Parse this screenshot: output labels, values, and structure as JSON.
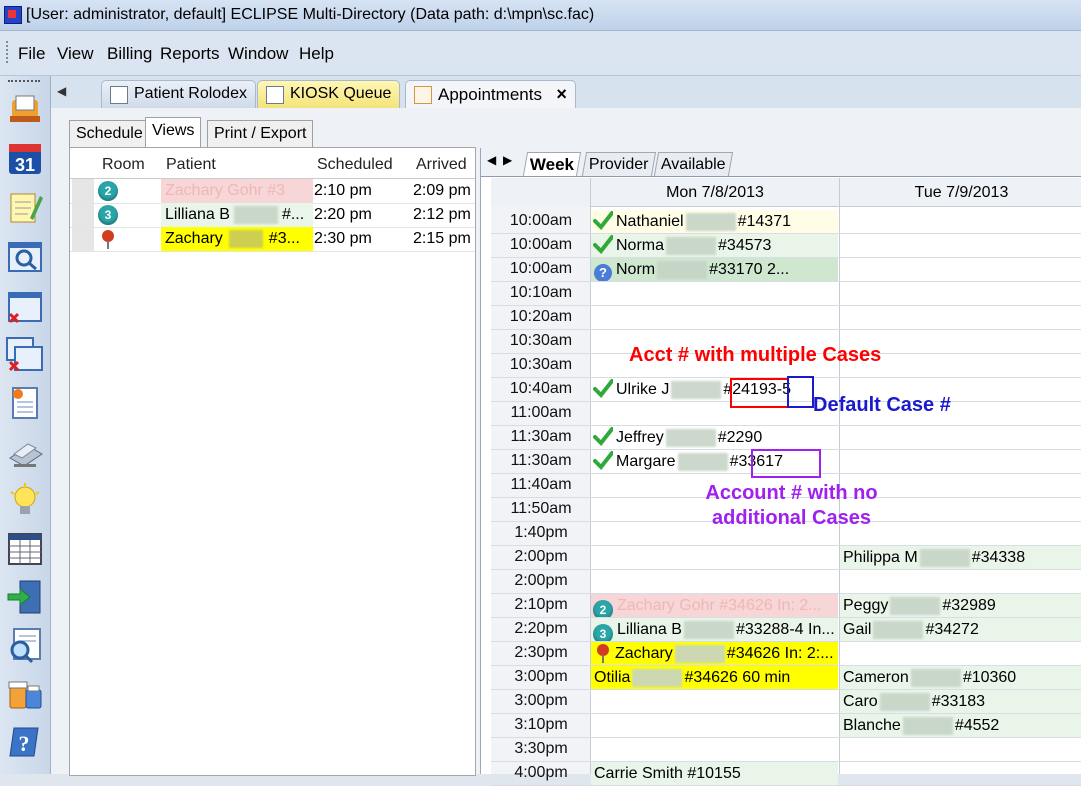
{
  "window": {
    "title": "[User: administrator, default]  ECLIPSE Multi-Directory (Data path: d:\\mpn\\sc.fac)"
  },
  "menu": [
    "File",
    "View",
    "Billing",
    "Reports",
    "Window",
    "Help"
  ],
  "toolbar_icons": [
    "rolodex-icon",
    "calendar-31-icon",
    "notepad-icon",
    "search-window-icon",
    "window-close-icon",
    "windows-close-icon",
    "report-icon",
    "scanner-icon",
    "lightbulb-icon",
    "grid-icon",
    "exit-door-icon",
    "search-list-icon",
    "medicine-icon",
    "help-icon"
  ],
  "toolbar_calendar_day": "31",
  "doc_tabs": [
    {
      "label": "Patient Rolodex"
    },
    {
      "label": "KIOSK Queue"
    },
    {
      "label": "Appointments",
      "active": true,
      "close": "×"
    }
  ],
  "sub_tabs": [
    "Schedule",
    "Views",
    "Print / Export"
  ],
  "left_table": {
    "headers": [
      "Room",
      "Patient",
      "Scheduled",
      "Arrived"
    ],
    "rows": [
      {
        "room": "2",
        "patient": "Zachary  Gohr #3",
        "scheduled": "2:10 pm",
        "arrived": "2:09 pm",
        "bg": "#f6d6d6",
        "textcolor": "#f1b6b6"
      },
      {
        "room": "3",
        "patient": "Lilliana B",
        "patient_tail": "#...",
        "scheduled": "2:20 pm",
        "arrived": "2:12 pm",
        "bg": "#e8f5e8",
        "textcolor": "#000"
      },
      {
        "room": "",
        "patient": "Zachary",
        "patient_tail": "#3...",
        "scheduled": "2:30 pm",
        "arrived": "2:15 pm",
        "bg": "#ffff00",
        "textcolor": "#000"
      }
    ]
  },
  "calendar": {
    "tabs": [
      "Week",
      "Provider",
      "Available"
    ],
    "days": [
      "Mon 7/8/2013",
      "Tue 7/9/2013"
    ],
    "times": [
      "10:00am",
      "10:00am",
      "10:00am",
      "10:10am",
      "10:20am",
      "10:30am",
      "10:30am",
      "10:40am",
      "11:00am",
      "11:30am",
      "11:30am",
      "11:40am",
      "11:50am",
      "1:40pm",
      "2:00pm",
      "2:00pm",
      "2:10pm",
      "2:20pm",
      "2:30pm",
      "3:00pm",
      "3:00pm",
      "3:10pm",
      "3:30pm",
      "4:00pm"
    ],
    "mon": [
      {
        "row": 0,
        "icon": "check",
        "text": "Nathaniel",
        "tail": "#14371",
        "bg": "#fffde6"
      },
      {
        "row": 1,
        "icon": "check",
        "text": "Norma",
        "tail": "#34573",
        "bg": "#e8f5e8"
      },
      {
        "row": 2,
        "icon": "question",
        "text": "Norm",
        "tail": "#33170  2...",
        "bg": "#cfe6cf"
      },
      {
        "row": 7,
        "icon": "check",
        "text": "Ulrike J",
        "tail": "#24193-5",
        "bg": "#ffffff"
      },
      {
        "row": 9,
        "icon": "check",
        "text": "Jeffrey",
        "tail": "#2290",
        "bg": "#ffffff"
      },
      {
        "row": 10,
        "icon": "check",
        "text": "Margare",
        "tail": "#33617",
        "bg": "#ffffff"
      },
      {
        "row": 16,
        "icon": "badge2",
        "text": "Zachary  Gohr #34626  In: 2...",
        "tail": "",
        "bg": "#f6d6d6",
        "color": "#f1b6b6"
      },
      {
        "row": 17,
        "icon": "badge3",
        "text": "Lilliana B",
        "tail": "#33288-4   In...",
        "bg": "#e8f5e8"
      },
      {
        "row": 18,
        "icon": "pin",
        "text": "Zachary",
        "tail": "#34626  In: 2:...",
        "bg": "#ffff00"
      },
      {
        "row": 19,
        "icon": "",
        "text": "Otilia",
        "tail": "#34626  60 min",
        "bg": "#ffff00"
      },
      {
        "row": 23,
        "icon": "",
        "text": "Carrie  Smith  #10155",
        "tail": "",
        "bg": "#e8f5e8"
      }
    ],
    "tue": [
      {
        "row": 14,
        "text": "Philippa M",
        "tail": "#34338",
        "bg": "#e8f5e8"
      },
      {
        "row": 16,
        "text": "Peggy",
        "tail": "#32989",
        "bg": "#e8f5e8"
      },
      {
        "row": 17,
        "text": "Gail",
        "tail": "#34272",
        "bg": "#e8f5e8"
      },
      {
        "row": 19,
        "text": "Cameron",
        "tail": "#10360",
        "bg": "#e8f5e8"
      },
      {
        "row": 20,
        "text": "Caro",
        "tail": "#33183",
        "bg": "#e8f5e8"
      },
      {
        "row": 21,
        "text": "Blanche",
        "tail": "#4552",
        "bg": "#e8f5e8"
      }
    ]
  },
  "annotations": {
    "multi_cases": "Acct # with multiple Cases",
    "default_case": "Default Case #",
    "no_cases_line1": "Account # with no",
    "no_cases_line2": "additional Cases",
    "red": "#ff0000",
    "blue": "#1a1acc",
    "purple": "#a020f0"
  }
}
